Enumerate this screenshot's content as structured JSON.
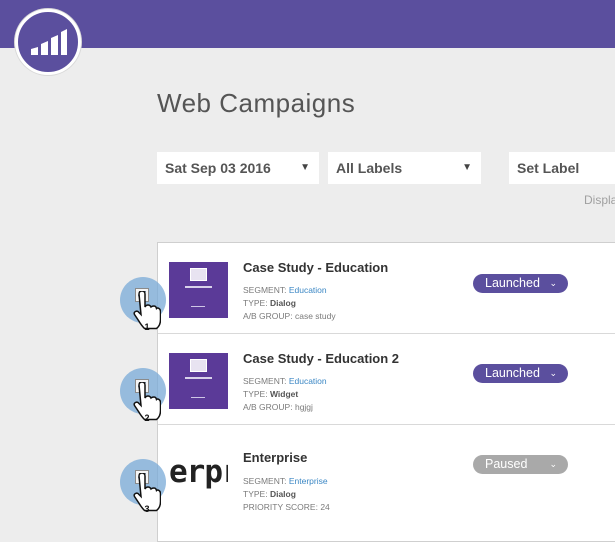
{
  "header": {
    "logo_icon": "marketo-bars-icon",
    "brand_color": "#5b4f9e"
  },
  "page": {
    "title": "Web Campaigns",
    "display_text": "Displa"
  },
  "filters": {
    "date": "Sat Sep 03 2016",
    "labels": "All Labels",
    "set_label": "Set Label",
    "caret": "▼"
  },
  "campaigns": [
    {
      "name": "Case Study - Education",
      "segment_label": "SEGMENT:",
      "segment": "Education",
      "type_label": "TYPE:",
      "type": "Dialog",
      "extra_label": "A/B GROUP:",
      "extra": "case study",
      "status": "Launched",
      "status_color": "#5b4f9e",
      "thumb": "dialog-preview",
      "cursor_number": "1",
      "checked": "✔"
    },
    {
      "name": "Case Study - Education 2",
      "segment_label": "SEGMENT:",
      "segment": "Education",
      "type_label": "TYPE:",
      "type": "Widget",
      "extra_label": "A/B GROUP:",
      "extra": "hgjgj",
      "status": "Launched",
      "status_color": "#5b4f9e",
      "thumb": "dialog-preview",
      "cursor_number": "2",
      "checked": "✔"
    },
    {
      "name": "Enterprise",
      "segment_label": "SEGMENT:",
      "segment": "Enterprise",
      "type_label": "TYPE:",
      "type": "Dialog",
      "extra_label": "PRIORITY SCORE:",
      "extra": "24",
      "status": "Paused",
      "status_color": "#a9a9a9",
      "thumb_text": "erpr",
      "cursor_number": "3",
      "checked": "✔"
    }
  ],
  "status_dropdown_icon": "chevron-down-icon",
  "status_dropdown_glyph": "⌄"
}
